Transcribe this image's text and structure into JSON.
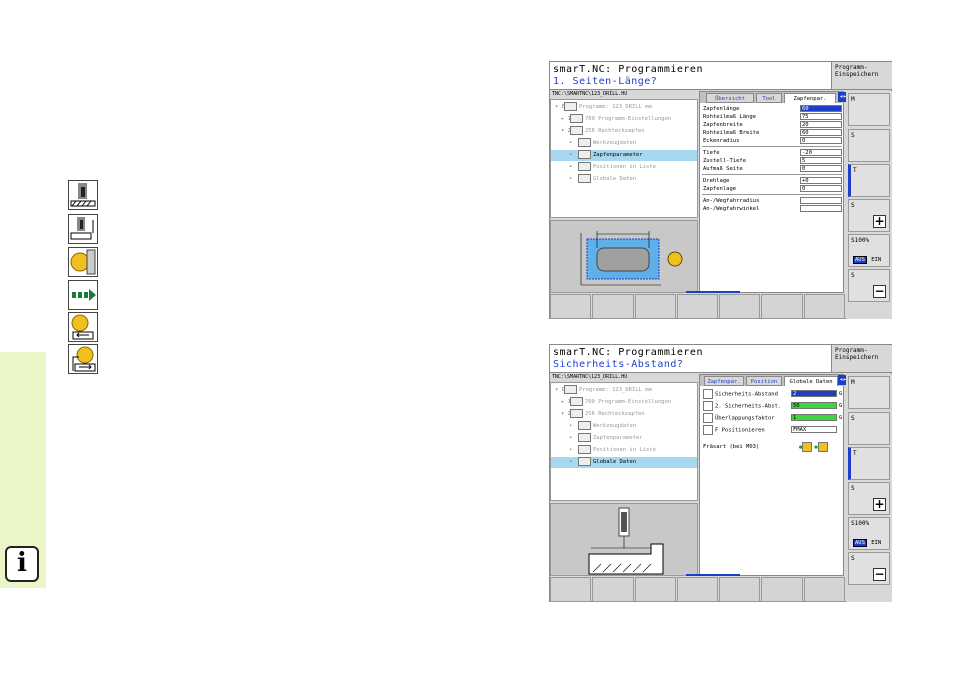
{
  "sidebar": {
    "info_label": "i"
  },
  "left_icons": [
    "tool-length-icon",
    "tool-length-side-icon",
    "milling-cutter-icon",
    "arrow-right-icon",
    "rotate-down-icon",
    "rotate-up-icon"
  ],
  "screen1": {
    "title": "smarT.NC: Programmieren",
    "subtitle": "1. Seiten-Länge?",
    "hbtn": "Programm-\nEinspeichern",
    "path": "TNC:\\SMARTNC\\123_DRILL.HU",
    "tree": [
      {
        "bullet": "▾ 0",
        "label": "Programm: 123_DRILL mm",
        "sel": false
      },
      {
        "bullet": "▸ 1",
        "label": "700 Programm-Einstellungen",
        "sel": false
      },
      {
        "bullet": "▾ 2",
        "label": "256 Rechteckzapfen",
        "sel": false
      },
      {
        "bullet": "•",
        "label": "Werkzeugdaten",
        "sel": false
      },
      {
        "bullet": "•",
        "label": "Zapfenparameter",
        "sel": true
      },
      {
        "bullet": "•",
        "label": "Positionen in Liste",
        "sel": false
      },
      {
        "bullet": "•",
        "label": "Globale Daten",
        "sel": false
      }
    ],
    "tabs": [
      "Übersicht",
      "Tool",
      "Zapfenpar."
    ],
    "rows": [
      {
        "label": "Zapfenlänge",
        "value": "60",
        "hl": true
      },
      {
        "label": "Rohteilmaß Länge",
        "value": "75",
        "hl": false
      },
      {
        "label": "Zapfenbreite",
        "value": "20",
        "hl": false
      },
      {
        "label": "Rohteilmaß Breite",
        "value": "60",
        "hl": false
      },
      {
        "label": "Eckenradius",
        "value": "0",
        "hl": false
      },
      {
        "label": "Tiefe",
        "value": "-20",
        "hl": false
      },
      {
        "label": "Zustell-Tiefe",
        "value": "5",
        "hl": false
      },
      {
        "label": "Aufmaß Seite",
        "value": "0",
        "hl": false
      },
      {
        "label": "Drehlage",
        "value": "+0",
        "hl": false
      },
      {
        "label": "Zapfenlage",
        "value": "0",
        "hl": false
      },
      {
        "label": "An-/Wegfahrradius",
        "value": "",
        "hl": false
      },
      {
        "label": "An-/Wegfahrwinkel",
        "value": "",
        "hl": false
      }
    ]
  },
  "screen2": {
    "title": "smarT.NC: Programmieren",
    "subtitle": "Sicherheits-Abstand?",
    "hbtn": "Programm-\nEinspeichern",
    "path": "TNC:\\SMARTNC\\123_DRILL.HU",
    "tree": [
      {
        "bullet": "▾ 0",
        "label": "Programm: 123_DRILL mm",
        "sel": false
      },
      {
        "bullet": "▸ 1",
        "label": "700 Programm-Einstellungen",
        "sel": false
      },
      {
        "bullet": "▾ 2",
        "label": "256 Rechteckzapfen",
        "sel": false
      },
      {
        "bullet": "•",
        "label": "Werkzeugdaten",
        "sel": false
      },
      {
        "bullet": "•",
        "label": "Zapfenparameter",
        "sel": false
      },
      {
        "bullet": "•",
        "label": "Positionen in Liste",
        "sel": false
      },
      {
        "bullet": "•",
        "label": "Globale Daten",
        "sel": true
      }
    ],
    "tabs": [
      "Zapfenpar.",
      "Position",
      "Globale Daten"
    ],
    "rows": [
      {
        "label": "Sicherheits-Abstand",
        "value": "2",
        "color": "blue",
        "suffix": "G"
      },
      {
        "label": "2. Sicherheits-Abst.",
        "value": "50",
        "color": "green",
        "suffix": "G"
      },
      {
        "label": "Überlappungsfaktor",
        "value": "1",
        "color": "green",
        "suffix": "G"
      },
      {
        "label": "F Positionieren",
        "value": "FMAX",
        "color": "white",
        "suffix": ""
      }
    ],
    "fraesart": "Fräsart (bei M03)"
  },
  "right_bar": {
    "m": "M",
    "s": "S",
    "t": "T",
    "s_plus": "S",
    "percent": "S100%",
    "aus": "AUS",
    "ein": "EIN",
    "f_minus": "S"
  }
}
